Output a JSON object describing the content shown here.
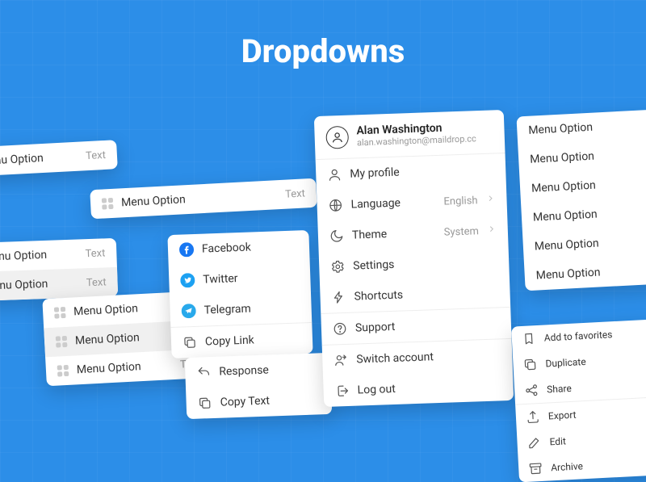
{
  "title": "Dropdowns",
  "menuOption": "Menu Option",
  "text": "Text",
  "share": {
    "facebook": "Facebook",
    "twitter": "Twitter",
    "telegram": "Telegram",
    "copyLink": "Copy Link"
  },
  "actions": {
    "response": "Response",
    "copyText": "Copy Text"
  },
  "profile": {
    "name": "Alan Washington",
    "email": "alan.washington@maildrop.cc",
    "myProfile": "My profile",
    "language": "Language",
    "languageValue": "English",
    "theme": "Theme",
    "themeValue": "System",
    "settings": "Settings",
    "shortcuts": "Shortcuts",
    "support": "Support",
    "switchAccount": "Switch account",
    "logOut": "Log out"
  },
  "context": {
    "addFav": "Add to favorites",
    "duplicate": "Duplicate",
    "share": "Share",
    "export": "Export",
    "edit": "Edit",
    "archive": "Archive"
  }
}
